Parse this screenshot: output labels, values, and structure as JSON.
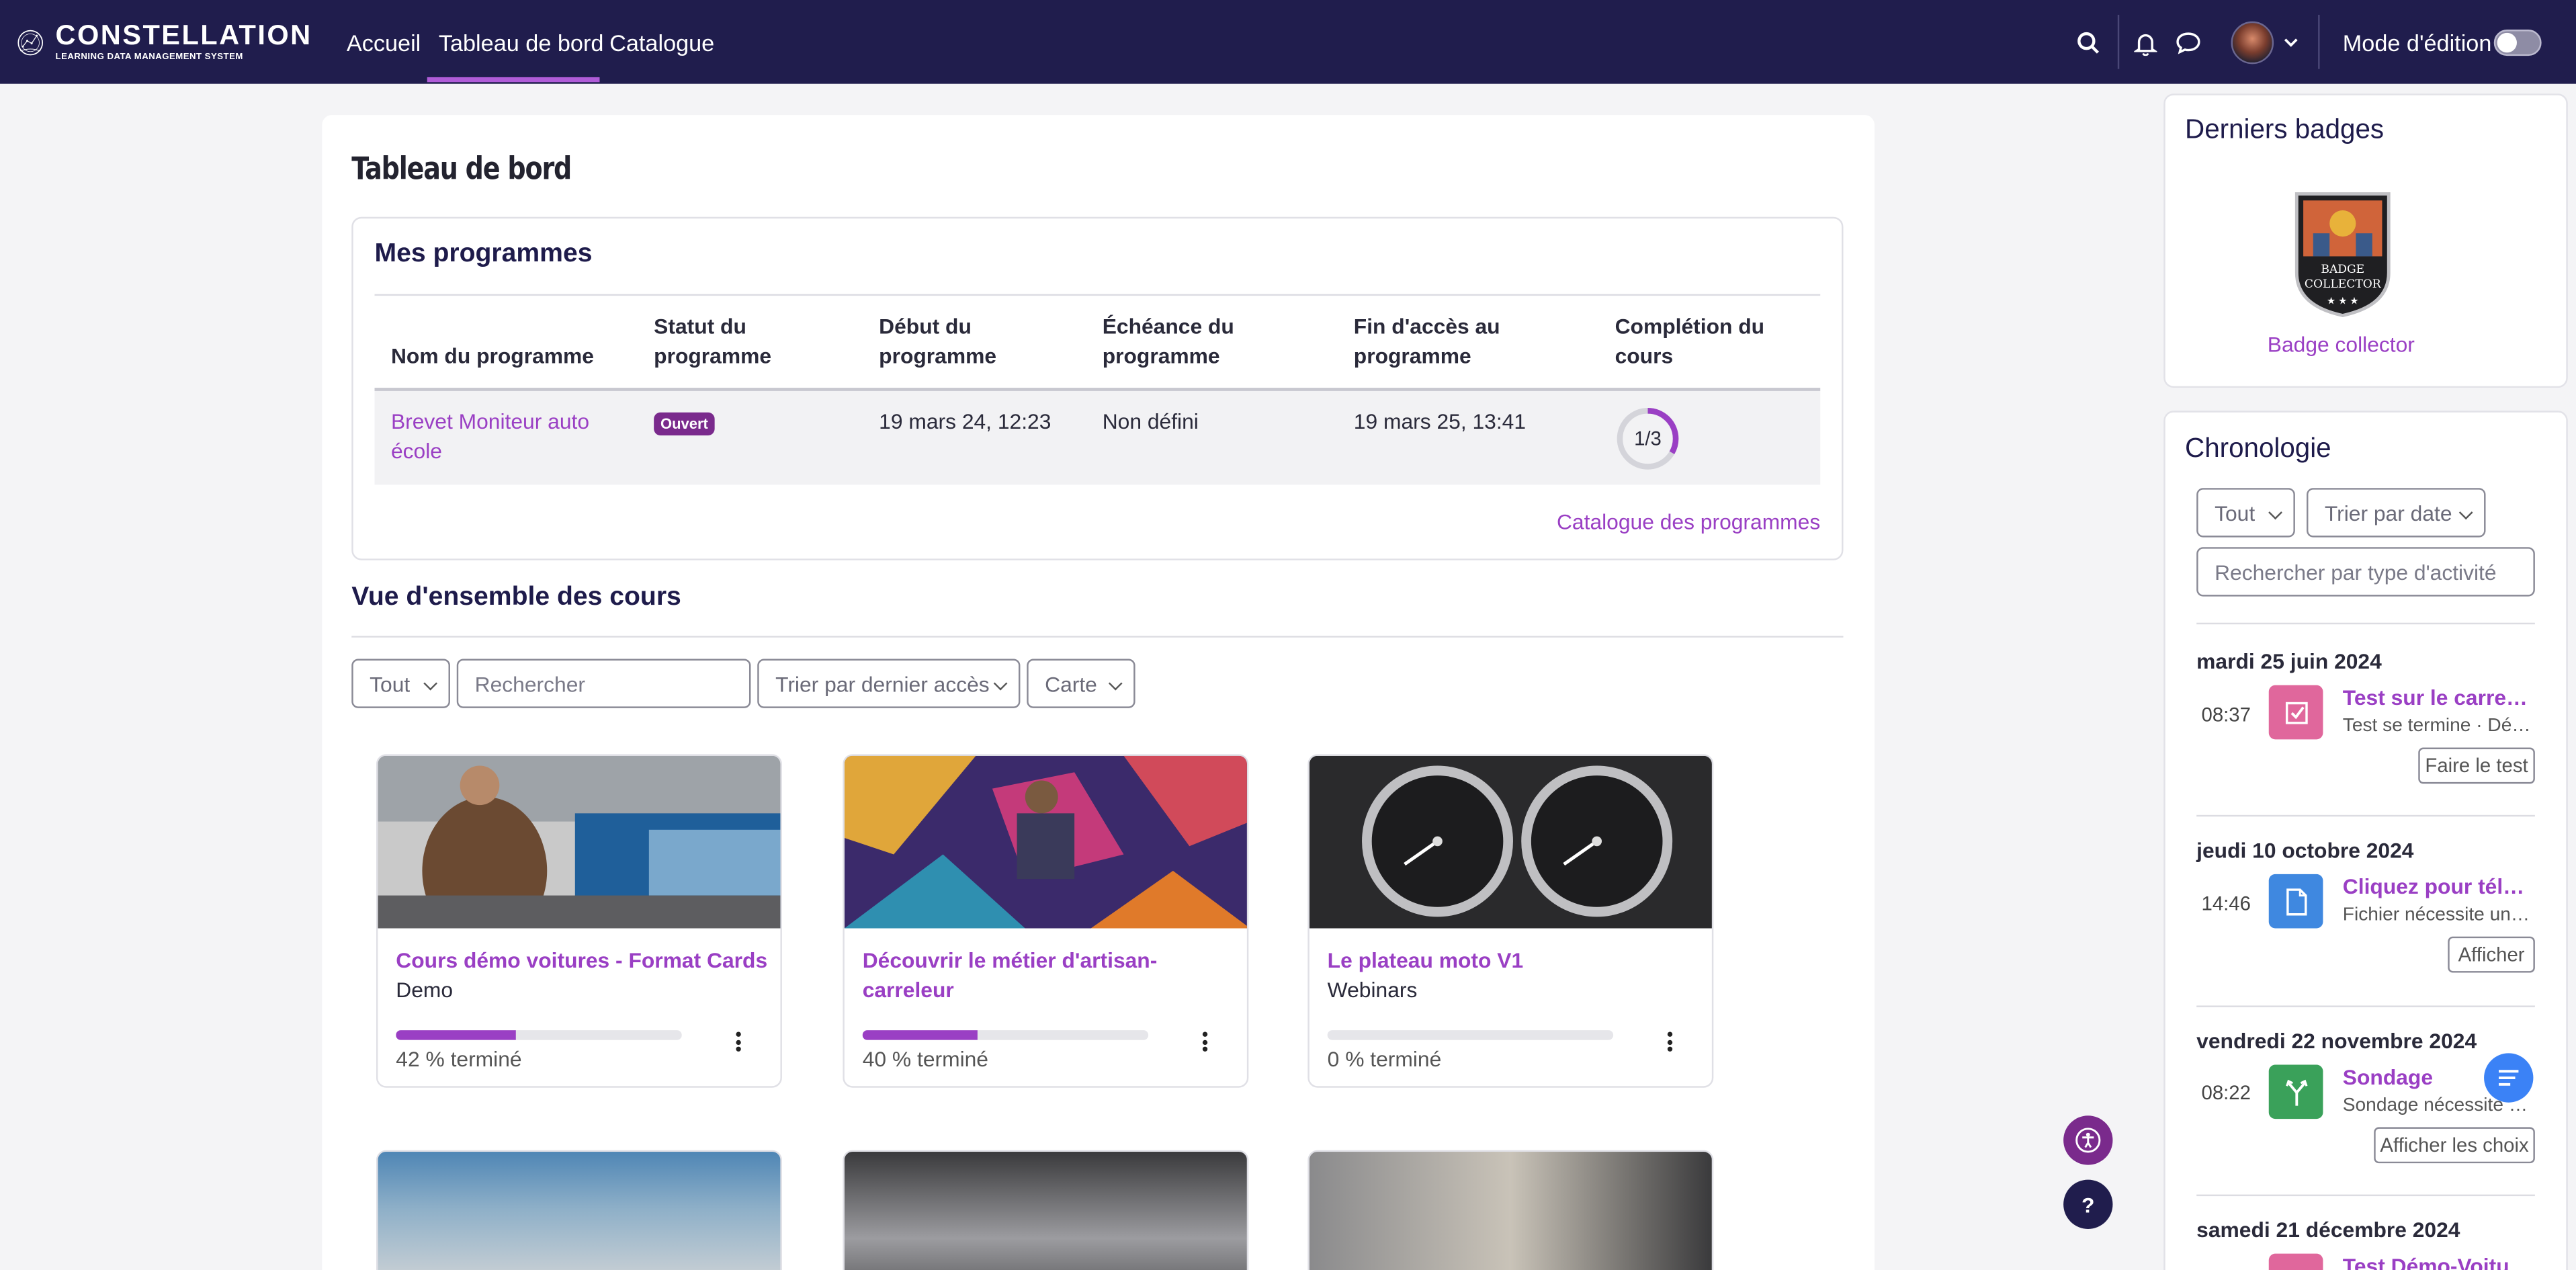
{
  "brand": {
    "name": "CONSTELLATION",
    "tagline": "LEARNING DATA MANAGEMENT SYSTEM"
  },
  "nav": {
    "items": [
      "Accueil",
      "Tableau de bord",
      "Catalogue"
    ],
    "active": "Tableau de bord"
  },
  "header": {
    "edit_mode_label": "Mode d'édition",
    "edit_mode_on": false,
    "icons": [
      "search-icon",
      "bell-icon",
      "chat-icon",
      "avatar",
      "chevron-down-icon"
    ]
  },
  "page": {
    "title": "Tableau de bord"
  },
  "programs": {
    "title": "Mes programmes",
    "columns": [
      "Nom du programme",
      "Statut du programme",
      "Début du programme",
      "Échéance du programme",
      "Fin d'accès au programme",
      "Complétion du cours"
    ],
    "rows": [
      {
        "name": "Brevet Moniteur auto école",
        "status": "Ouvert",
        "start": "19 mars 24, 12:23",
        "deadline": "Non défini",
        "end": "19 mars 25, 13:41",
        "completion": "1/3",
        "completion_fraction": 0.333
      }
    ],
    "catalog_link": "Catalogue des programmes"
  },
  "overview": {
    "title": "Vue d'ensemble des cours",
    "filter": "Tout",
    "search_placeholder": "Rechercher",
    "sort": "Trier par dernier accès",
    "view": "Carte"
  },
  "courses": [
    {
      "title": "Cours démo voitures - Format Cards",
      "category": "Demo",
      "progress": 42,
      "progress_text": "42 % terminé"
    },
    {
      "title": "Découvrir le métier d'artisan-carreleur",
      "category": "",
      "progress": 40,
      "progress_text": "40 % terminé"
    },
    {
      "title": "Le plateau moto V1",
      "category": "Webinars",
      "progress": 0,
      "progress_text": "0 % terminé"
    }
  ],
  "badges": {
    "title": "Derniers badges",
    "items": [
      {
        "name": "Badge collector",
        "text": [
          "BADGE",
          "COLLECTOR"
        ]
      }
    ]
  },
  "timeline": {
    "title": "Chronologie",
    "filter": "Tout",
    "sort": "Trier par date",
    "search_placeholder": "Rechercher par type d'activité",
    "groups": [
      {
        "date": "mardi 25 juin 2024",
        "time": "08:37",
        "title": "Test sur le carrelage",
        "desc": "Test se termine · Découvrir",
        "button": "Faire le test",
        "icon": "quiz-icon",
        "color": "#e0679c"
      },
      {
        "date": "jeudi 10 octobre 2024",
        "time": "14:46",
        "title": "Cliquez pour télécharger",
        "desc": "Fichier nécessite une action",
        "button": "Afficher",
        "icon": "file-icon",
        "color": "#3f88e0"
      },
      {
        "date": "vendredi 22 novembre 2024",
        "time": "08:22",
        "title": "Sondage",
        "desc": "Sondage nécessite une action",
        "button": "Afficher les choix",
        "icon": "choice-icon",
        "color": "#3aa15a"
      },
      {
        "date": "samedi 21 décembre 2024",
        "title": "Test Démo-Voitures"
      }
    ]
  },
  "colors": {
    "navbar": "#201d4d",
    "accent": "#9a3fc4",
    "fab_accessibility": "#7a2a8c",
    "fab_help": "#201d4d",
    "fab_chat": "#3b82f6"
  }
}
